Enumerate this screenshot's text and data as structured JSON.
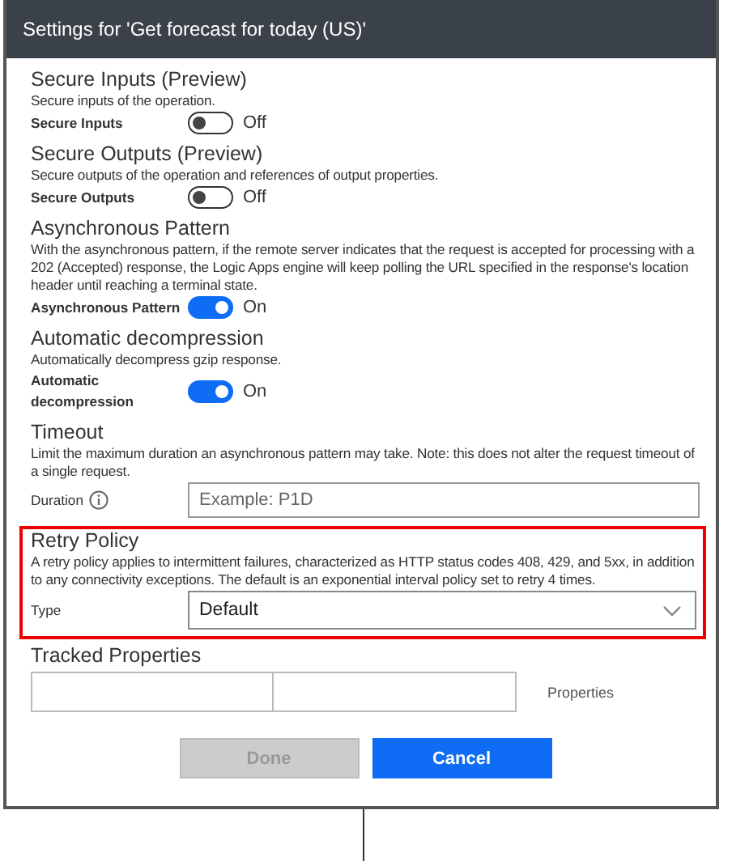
{
  "window": {
    "title": "Settings for 'Get forecast for today (US)'"
  },
  "sections": [
    {
      "kind": "toggle",
      "title": "Secure Inputs (Preview)",
      "description": "Secure inputs of the operation.",
      "label": "Secure Inputs",
      "on": false,
      "state_text": "Off",
      "highlighted": false
    },
    {
      "kind": "toggle",
      "title": "Secure Outputs (Preview)",
      "description": "Secure outputs of the operation and references of output properties.",
      "label": "Secure Outputs",
      "on": false,
      "state_text": "Off",
      "highlighted": false
    },
    {
      "kind": "toggle",
      "title": "Asynchronous Pattern",
      "description": "With the asynchronous pattern, if the remote server indicates that the request is accepted for processing with a 202 (Accepted) response, the Logic Apps engine will keep polling the URL specified in the response's location header until reaching a terminal state.",
      "label": "Asynchronous Pattern",
      "on": true,
      "state_text": "On",
      "highlighted": false
    },
    {
      "kind": "toggle",
      "title": "Automatic decompression",
      "description": "Automatically decompress gzip response.",
      "label": "Automatic decompression",
      "on": true,
      "state_text": "On",
      "highlighted": false
    },
    {
      "kind": "field",
      "title": "Timeout",
      "description": "Limit the maximum duration an asynchronous pattern may take. Note: this does not alter the request timeout of a single request.",
      "label": "Duration",
      "placeholder": "Example: P1D",
      "highlighted": false
    },
    {
      "kind": "select",
      "title": "Retry Policy",
      "description": "A retry policy applies to intermittent failures, characterized as HTTP status codes 408, 429, and 5xx, in addition to any connectivity exceptions. The default is an exponential interval policy set to retry 4 times.",
      "label": "Type",
      "value": "Default",
      "highlighted": true
    },
    {
      "kind": "tracked",
      "title": "Tracked Properties",
      "side_label": "Properties",
      "highlighted": false
    }
  ],
  "buttons": [
    {
      "label": "Done",
      "disabled": true,
      "primary": false
    },
    {
      "label": "Cancel",
      "disabled": false,
      "primary": true
    }
  ]
}
